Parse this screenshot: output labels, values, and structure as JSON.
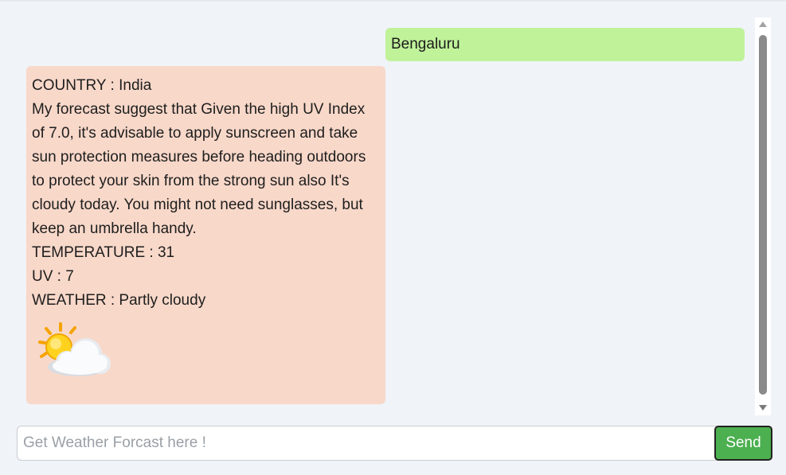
{
  "chat": {
    "user_message": "Bengaluru",
    "bot_message": {
      "country": "COUNTRY : India",
      "forecast": "My forecast suggest that Given the high UV Index of 7.0, it's advisable to apply sunscreen and take sun protection measures before heading outdoors to protect your skin from the strong sun also It's cloudy today. You might not need sunglasses, but keep an umbrella handy.",
      "temperature": "TEMPERATURE : 31",
      "uv": "UV : 7",
      "weather": "WEATHER : Partly cloudy",
      "weather_icon": "partly-cloudy-sun-icon"
    }
  },
  "input": {
    "placeholder": "Get Weather Forcast here !",
    "value": ""
  },
  "send_button": {
    "label": "Send",
    "color": "#4caf50"
  },
  "colors": {
    "user_bubble": "#c0f29a",
    "bot_bubble": "#f8d8c9",
    "background": "#f0f3f8"
  }
}
